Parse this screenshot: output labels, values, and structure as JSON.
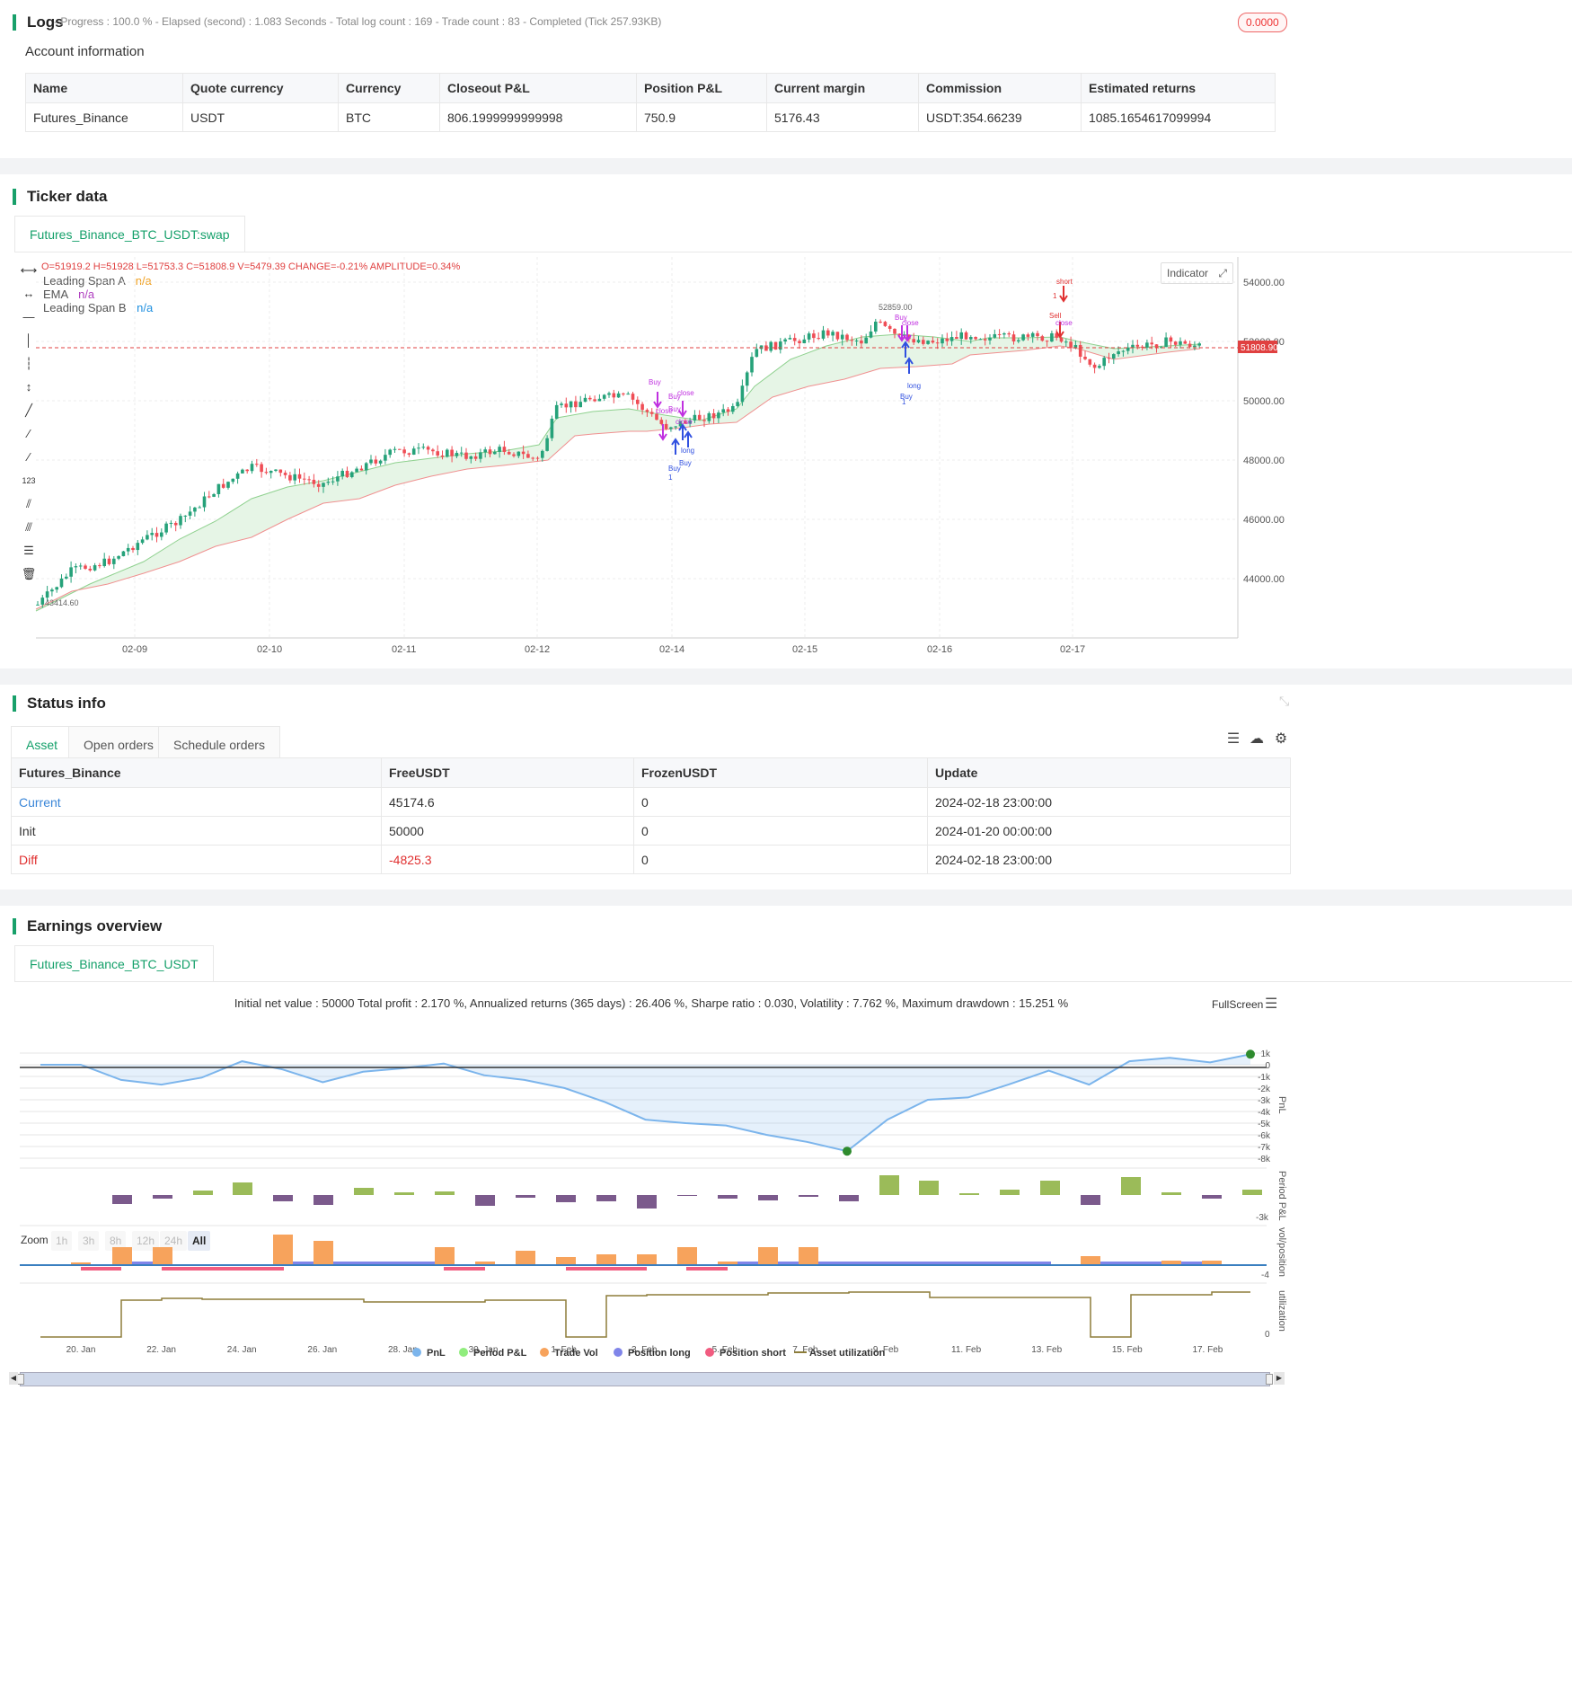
{
  "logs": {
    "title": "Logs",
    "summary": "- Progress : 100.0 % - Elapsed (second) : 1.083  Seconds - Total log count : 169 - Trade count : 83 - Completed (Tick 257.93KB)",
    "badge": "0.0000"
  },
  "account": {
    "title": "Account information",
    "headers": [
      "Name",
      "Quote currency",
      "Currency",
      "Closeout P&L",
      "Position P&L",
      "Current margin",
      "Commission",
      "Estimated returns"
    ],
    "row": [
      "Futures_Binance",
      "USDT",
      "BTC",
      "806.1999999999998",
      "750.9",
      "5176.43",
      "USDT:354.66239",
      "1085.1654617099994"
    ]
  },
  "ticker": {
    "title": "Ticker data",
    "tab": "Futures_Binance_BTC_USDT:swap",
    "ohlc": "O=51919.2 H=51928 L=51753.3 C=51808.9 V=5479.39 CHANGE=-0.21% AMPLITUDE=0.34%",
    "legend": [
      {
        "name": "Leading Span A",
        "value": "n/a",
        "color": "#f0a020"
      },
      {
        "name": "EMA",
        "value": "n/a",
        "color": "#b040c0"
      },
      {
        "name": "Leading Span B",
        "value": "n/a",
        "color": "#2090e0"
      }
    ],
    "indicator_btn": "Indicator",
    "y_labels": [
      "54000.00",
      "52000.00",
      "50000.00",
      "48000.00",
      "46000.00",
      "44000.00"
    ],
    "x_labels": [
      "02-09",
      "02-10",
      "02-11",
      "02-12",
      "02-14",
      "02-15",
      "02-16",
      "02-17"
    ],
    "last_price": "51808.90",
    "high_label": "52859.00",
    "low_label": "43414.60",
    "markers": [
      {
        "text": "short",
        "color": "#e03030"
      },
      {
        "text": "1",
        "color": "#e03030"
      },
      {
        "text": "Sell",
        "color": "#e03030"
      },
      {
        "text": "close",
        "color": "#c030e0"
      },
      {
        "text": "Buy",
        "color": "#c030e0"
      },
      {
        "text": "close",
        "color": "#c030e0"
      },
      {
        "text": "Buy",
        "color": "#c030e0"
      },
      {
        "text": "close",
        "color": "#c030e0"
      },
      {
        "text": "long",
        "color": "#3050e0"
      },
      {
        "text": "Buy",
        "color": "#3050e0"
      },
      {
        "text": "1",
        "color": "#3050e0"
      },
      {
        "text": "Buy",
        "color": "#c030e0"
      },
      {
        "text": "close",
        "color": "#c030e0"
      },
      {
        "text": "Buy",
        "color": "#c030e0"
      },
      {
        "text": "close",
        "color": "#c030e0"
      },
      {
        "text": "long",
        "color": "#3050e0"
      },
      {
        "text": "Buy",
        "color": "#3050e0"
      },
      {
        "text": "Buy",
        "color": "#3050e0"
      },
      {
        "text": "1",
        "color": "#3050e0"
      }
    ]
  },
  "status": {
    "title": "Status info",
    "tabs": [
      "Asset",
      "Open orders",
      "Schedule orders"
    ],
    "headers": [
      "Futures_Binance",
      "FreeUSDT",
      "FrozenUSDT",
      "Update"
    ],
    "rows": [
      [
        "Current",
        "45174.6",
        "0",
        "2024-02-18 23:00:00"
      ],
      [
        "Init",
        "50000",
        "0",
        "2024-01-20 00:00:00"
      ],
      [
        "Diff",
        "-4825.3",
        "0",
        "2024-02-18 23:00:00"
      ]
    ]
  },
  "earnings": {
    "title": "Earnings overview",
    "tab": "Futures_Binance_BTC_USDT",
    "summary": "Initial net value : 50000 Total profit : 2.170 %, Annualized returns (365 days) : 26.406 %, Sharpe ratio : 0.030, Volatility : 7.762 %, Maximum drawdown : 15.251 %",
    "fullscreen": "FullScreen",
    "zoom_label": "Zoom",
    "zoom_options": [
      "1h",
      "3h",
      "8h",
      "12h",
      "24h",
      "All"
    ],
    "pnl_y": [
      "1k",
      "0",
      "-1k",
      "-2k",
      "-3k",
      "-4k",
      "-5k",
      "-6k",
      "-7k",
      "-8k"
    ],
    "period_y": "-3k",
    "vol_y": "-4",
    "util_y": "0",
    "axis_titles": [
      "PnL",
      "Period P&L",
      "vol/position",
      "utilization"
    ],
    "x_labels": [
      "20. Jan",
      "22. Jan",
      "24. Jan",
      "26. Jan",
      "28. Jan",
      "30. Jan",
      "1. Feb",
      "3. Feb",
      "5. Feb",
      "7. Feb",
      "9. Feb",
      "11. Feb",
      "13. Feb",
      "15. Feb",
      "17. Feb"
    ],
    "legend": [
      {
        "name": "PnL",
        "color": "#7cb5ec"
      },
      {
        "name": "Period P&L",
        "color": "#90ed7d"
      },
      {
        "name": "Trade Vol",
        "color": "#f7a35c"
      },
      {
        "name": "Position long",
        "color": "#8085e9"
      },
      {
        "name": "Position short",
        "color": "#f15c80"
      },
      {
        "name": "Asset utilization",
        "color": "#8d7d3a"
      }
    ]
  },
  "chart_data": [
    {
      "type": "line",
      "title": "",
      "ylabel": "PnL",
      "x": [
        "20. Jan",
        "21. Jan",
        "22. Jan",
        "23. Jan",
        "24. Jan",
        "25. Jan",
        "26. Jan",
        "27. Jan",
        "28. Jan",
        "29. Jan",
        "30. Jan",
        "31. Jan",
        "1. Feb",
        "2. Feb",
        "3. Feb",
        "4. Feb",
        "5. Feb",
        "6. Feb",
        "7. Feb",
        "8. Feb",
        "9. Feb",
        "10. Feb",
        "11. Feb",
        "12. Feb",
        "13. Feb",
        "14. Feb",
        "15. Feb",
        "16. Feb",
        "17. Feb",
        "18. Feb"
      ],
      "series": [
        {
          "values": [
            0,
            0,
            -1300,
            -1700,
            -1100,
            300,
            -400,
            -1500,
            -600,
            -300,
            100,
            -900,
            -1300,
            -2000,
            -3200,
            -4700,
            -5000,
            -5200,
            -6000,
            -6600,
            -7400,
            -4700,
            -3000,
            -2800,
            -1700,
            -500,
            -1700,
            300,
            600,
            200,
            900
          ]
        }
      ],
      "ylim": [
        -8000,
        1000
      ]
    }
  ]
}
